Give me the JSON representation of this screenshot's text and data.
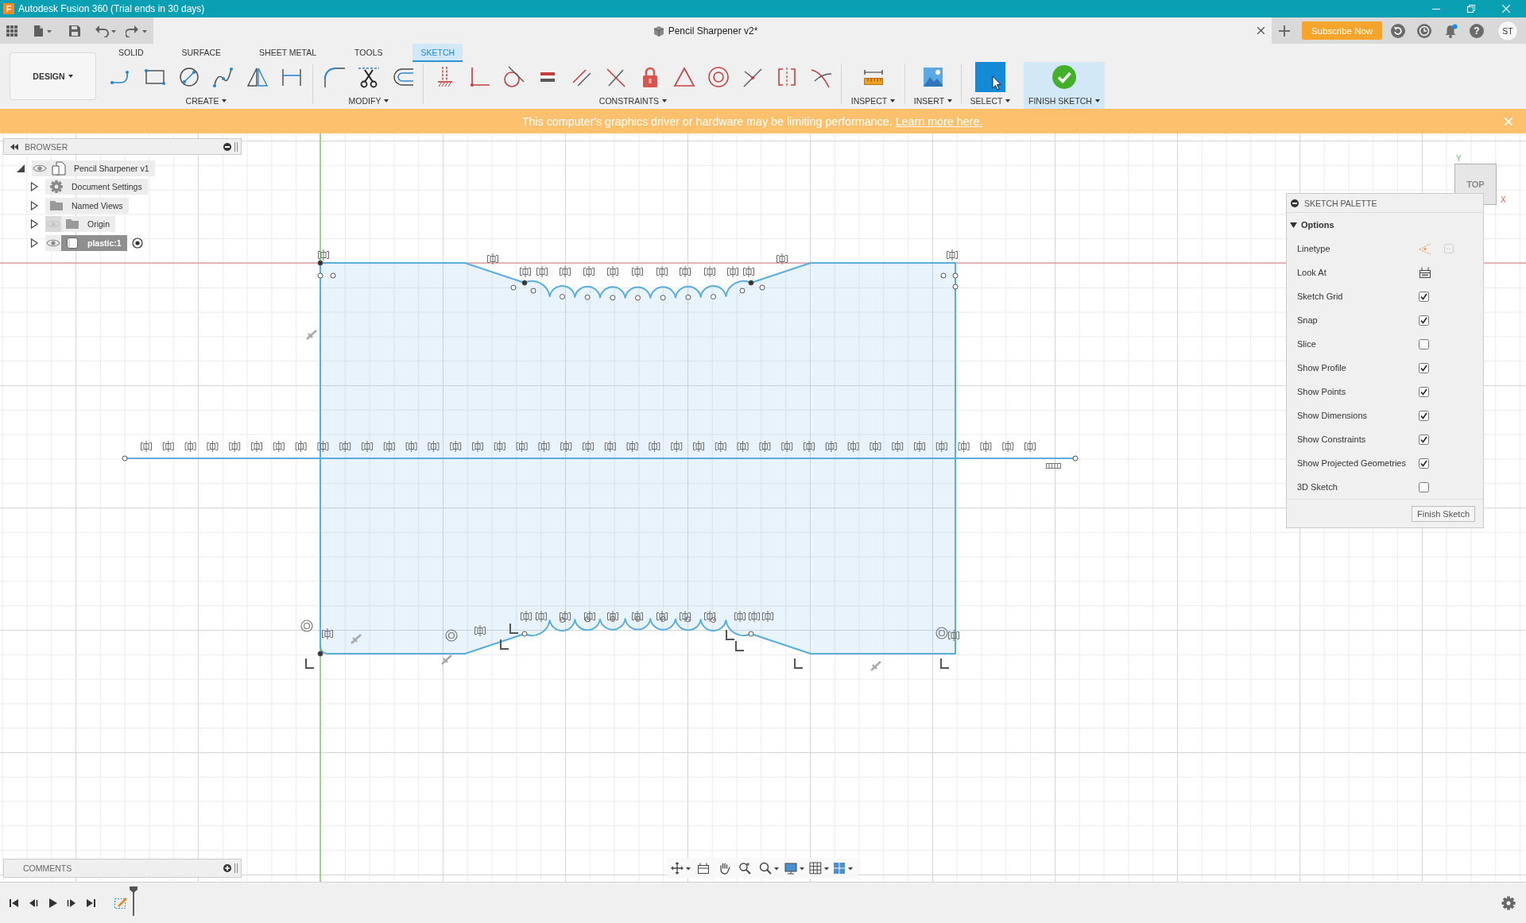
{
  "window": {
    "logo": "F",
    "title": "Autodesk Fusion 360 (Trial ends in 30 days)"
  },
  "app_bar": {
    "document_tab": "Pencil Sharpener v2*",
    "subscribe_button": "Subscribe Now",
    "help_button": "?",
    "user_initials": "ST"
  },
  "toolbar": {
    "workspace": "DESIGN",
    "tabs": [
      {
        "label": "SOLID",
        "selected": false
      },
      {
        "label": "SURFACE",
        "selected": false
      },
      {
        "label": "SHEET METAL",
        "selected": false
      },
      {
        "label": "TOOLS",
        "selected": false
      },
      {
        "label": "SKETCH",
        "selected": true
      }
    ],
    "groups": [
      {
        "kind": "create",
        "label": "CREATE"
      },
      {
        "kind": "modify",
        "label": "MODIFY"
      },
      {
        "kind": "constraints",
        "label": "CONSTRAINTS"
      },
      {
        "kind": "inspect",
        "label": "INSPECT"
      },
      {
        "kind": "insert",
        "label": "INSERT"
      },
      {
        "kind": "select",
        "label": "SELECT"
      },
      {
        "kind": "finish",
        "label": "FINISH SKETCH"
      }
    ]
  },
  "banner": {
    "message": "This computer's graphics driver or hardware may be limiting performance.",
    "link": "Learn more here."
  },
  "browser": {
    "title": "BROWSER",
    "tree": [
      {
        "label": "Pencil Sharpener v1",
        "kind": "component",
        "visible": true,
        "expanded": true,
        "selected": false,
        "children": [
          {
            "label": "Document Settings",
            "kind": "settings",
            "expanded": false,
            "selected": false
          },
          {
            "label": "Named Views",
            "kind": "folder",
            "expanded": false,
            "selected": false
          },
          {
            "label": "Origin",
            "kind": "folder",
            "visible": false,
            "expanded": false,
            "selected": false
          },
          {
            "label": "plastic:1",
            "kind": "body",
            "visible": true,
            "expanded": false,
            "selected": true
          }
        ]
      }
    ]
  },
  "view_cube": {
    "face": "TOP",
    "y_axis": "Y",
    "x_axis": "X"
  },
  "sketch_palette": {
    "title": "SKETCH PALETTE",
    "section": {
      "label": "Options",
      "expanded": true
    },
    "options": [
      {
        "label": "Linetype",
        "kind": "linetype"
      },
      {
        "label": "Look At",
        "kind": "action"
      },
      {
        "label": "Sketch Grid",
        "kind": "checkbox",
        "checked": true
      },
      {
        "label": "Snap",
        "kind": "checkbox",
        "checked": true
      },
      {
        "label": "Slice",
        "kind": "checkbox",
        "checked": false
      },
      {
        "label": "Show Profile",
        "kind": "checkbox",
        "checked": true
      },
      {
        "label": "Show Points",
        "kind": "checkbox",
        "checked": true
      },
      {
        "label": "Show Dimensions",
        "kind": "checkbox",
        "checked": true
      },
      {
        "label": "Show Constraints",
        "kind": "checkbox",
        "checked": true
      },
      {
        "label": "Show Projected Geometries",
        "kind": "checkbox",
        "checked": true
      },
      {
        "label": "3D Sketch",
        "kind": "checkbox",
        "checked": false
      }
    ],
    "button": "Finish Sketch"
  },
  "comments": {
    "title": "COMMENTS"
  }
}
